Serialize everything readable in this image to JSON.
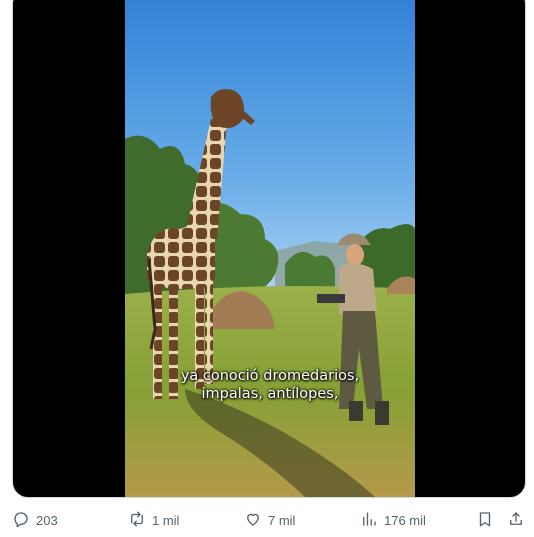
{
  "post": {
    "media": {
      "type": "video",
      "caption_lines": [
        "ya conoció dromedarios,",
        "impalas, antílopes,"
      ]
    },
    "actions": {
      "replies": {
        "icon": "reply-icon",
        "count": "203"
      },
      "reposts": {
        "icon": "repost-icon",
        "count": "1 mil"
      },
      "likes": {
        "icon": "heart-icon",
        "count": "7 mil"
      },
      "views": {
        "icon": "views-icon",
        "count": "176 mil"
      },
      "bookmark": {
        "icon": "bookmark-icon"
      },
      "share": {
        "icon": "share-icon"
      }
    }
  },
  "colors": {
    "border": "#cfd9de",
    "icon": "#536471",
    "sky_top": "#3a86d8",
    "sky_bottom": "#9fcbf0",
    "grass": "#8aa43a"
  }
}
